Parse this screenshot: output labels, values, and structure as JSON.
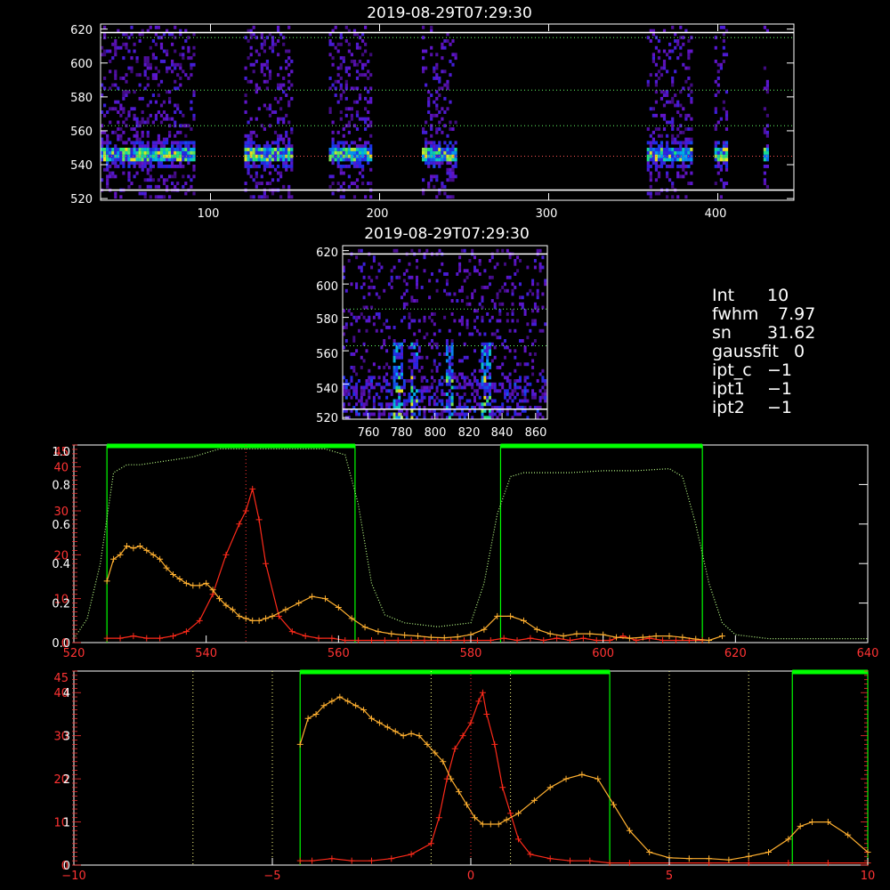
{
  "panel1": {
    "title": "2019-08-29T07:29:30",
    "x_ticks": [
      "100",
      "200",
      "300",
      "400"
    ],
    "y_ticks": [
      "520",
      "540",
      "560",
      "580",
      "600",
      "620"
    ]
  },
  "panel2": {
    "title": "2019-08-29T07:29:30",
    "x_ticks": [
      "760",
      "780",
      "800",
      "820",
      "840",
      "860"
    ],
    "y_ticks": [
      "520",
      "540",
      "560",
      "580",
      "600",
      "620"
    ]
  },
  "info": {
    "rows": [
      {
        "key": "Int",
        "value": "10"
      },
      {
        "key": "fwhm",
        "value": "7.97"
      },
      {
        "key": "sn",
        "value": "31.62"
      },
      {
        "key": "gaussfit",
        "value": "0"
      },
      {
        "key": "ipt_c",
        "value": "−1"
      },
      {
        "key": "ipt1",
        "value": "−1"
      },
      {
        "key": "ipt2",
        "value": "−1"
      }
    ]
  },
  "colors": {
    "axis": "#ffffff",
    "red": "#ff2a1a",
    "orange": "#ffb030",
    "green": "#00ff00",
    "lightgreen": "#bbff88",
    "yellow_dots": "#ffff88"
  },
  "chart_data": [
    {
      "type": "heatmap",
      "title": "2019-08-29T07:29:30",
      "xlim": [
        35,
        445
      ],
      "ylim": [
        519,
        623
      ],
      "x_ticks": [
        100,
        200,
        300,
        400
      ],
      "y_ticks": [
        520,
        540,
        560,
        580,
        600,
        620
      ],
      "bright_band_y": 545,
      "column_groups": [
        [
          35,
          90
        ],
        [
          120,
          148
        ],
        [
          170,
          195
        ],
        [
          225,
          245
        ],
        [
          358,
          385
        ],
        [
          398,
          405
        ],
        [
          427,
          430
        ]
      ],
      "reference_lines_y": [
        525,
        545,
        563,
        584,
        615,
        618
      ]
    },
    {
      "type": "heatmap",
      "title": "2019-08-29T07:29:30",
      "xlim": [
        745,
        867
      ],
      "ylim": [
        519,
        623
      ],
      "x_ticks": [
        760,
        780,
        800,
        820,
        840,
        860
      ],
      "y_ticks": [
        520,
        540,
        560,
        580,
        600,
        620
      ],
      "bright_columns_x": [
        777,
        787,
        808,
        830
      ],
      "reference_lines_y": [
        525,
        563,
        585,
        618
      ]
    },
    {
      "type": "line",
      "xlim": [
        520,
        640
      ],
      "x_ticks": [
        520,
        540,
        560,
        580,
        600,
        620,
        640
      ],
      "left_axis_outer": {
        "ticks": [
          "0",
          "10",
          "20",
          "30",
          "40"
        ],
        "top_label": "45",
        "color": "#ff2a1a",
        "ylim": [
          0,
          45
        ]
      },
      "left_axis_inner": {
        "ticks": [
          "0.0",
          "0.2",
          "0.4",
          "0.6",
          "0.8"
        ],
        "top_label": "1.0",
        "color": "#ffffff",
        "ylim": [
          0,
          1.0
        ]
      },
      "vertical_marker_x": 546,
      "green_bars": [
        [
          525,
          562.5
        ],
        [
          584.5,
          615
        ]
      ],
      "series": [
        {
          "color": "#ff2a1a",
          "axis": "outer",
          "x": [
            525,
            527,
            529,
            531,
            533,
            535,
            537,
            539,
            541,
            543,
            545,
            546,
            547,
            548,
            549,
            551,
            553,
            555,
            557,
            559,
            561,
            563,
            565,
            567,
            569,
            571,
            573,
            575,
            577,
            579,
            581,
            583,
            585,
            587,
            589,
            591,
            593,
            595,
            597,
            599,
            601,
            603,
            605,
            607,
            609,
            611,
            613,
            615
          ],
          "y": [
            1,
            1,
            1.5,
            1,
            1,
            1.5,
            2.5,
            5,
            11,
            20,
            27,
            30,
            35,
            28,
            18,
            6,
            2.5,
            1.5,
            1,
            1,
            0.5,
            0.5,
            0.5,
            0.5,
            0.5,
            0.5,
            0.5,
            0.5,
            0.5,
            0.5,
            0.5,
            0.5,
            1,
            0.5,
            1,
            0.5,
            1,
            0.5,
            1,
            0.5,
            0.5,
            1.5,
            0.5,
            1,
            0.5,
            0.5,
            0.5,
            0.5
          ]
        },
        {
          "color": "#ffb030",
          "axis": "outer",
          "x": [
            525,
            526,
            527,
            528,
            529,
            530,
            531,
            532,
            533,
            534,
            535,
            536,
            537,
            538,
            539,
            540,
            541,
            542,
            543,
            544,
            545,
            546,
            547,
            548,
            549,
            550,
            552,
            554,
            556,
            558,
            560,
            562,
            564,
            566,
            568,
            570,
            572,
            574,
            576,
            578,
            580,
            582,
            584,
            586,
            588,
            590,
            592,
            594,
            596,
            598,
            600,
            602,
            604,
            606,
            608,
            610,
            612,
            614,
            616,
            618
          ],
          "y": [
            14,
            19,
            20,
            22,
            21.5,
            22,
            21,
            20,
            19,
            17,
            15.5,
            14.5,
            13.5,
            13,
            13,
            13.5,
            12,
            10,
            8.5,
            7.5,
            6,
            5.5,
            5,
            5,
            5.5,
            6,
            7.5,
            9,
            10.5,
            10,
            8,
            5.5,
            3.5,
            2.5,
            2,
            1.7,
            1.5,
            1.2,
            1.1,
            1.3,
            1.8,
            3,
            6,
            6,
            5,
            3,
            2,
            1.5,
            2,
            2,
            1.8,
            1.2,
            1,
            1.2,
            1.5,
            1.5,
            1.2,
            0.8,
            0.5,
            1.5
          ]
        },
        {
          "color": "#bbff88",
          "axis": "inner",
          "style": "dotted",
          "x": [
            520,
            522,
            524,
            526,
            528,
            530,
            534,
            538,
            542,
            546,
            550,
            554,
            558,
            561,
            563,
            565,
            567,
            570,
            575,
            580,
            582,
            584,
            586,
            588,
            590,
            595,
            600,
            605,
            610,
            612,
            614,
            616,
            618,
            620,
            625,
            630,
            640
          ],
          "y": [
            0.02,
            0.12,
            0.4,
            0.86,
            0.9,
            0.9,
            0.92,
            0.94,
            0.98,
            0.98,
            0.98,
            0.98,
            0.98,
            0.95,
            0.7,
            0.3,
            0.14,
            0.1,
            0.08,
            0.1,
            0.3,
            0.65,
            0.84,
            0.86,
            0.86,
            0.86,
            0.87,
            0.87,
            0.88,
            0.84,
            0.6,
            0.3,
            0.1,
            0.04,
            0.02,
            0.02,
            0.02
          ]
        }
      ]
    },
    {
      "type": "line",
      "xlim": [
        -10,
        10
      ],
      "x_ticks": [
        -10,
        -5,
        0,
        5,
        10
      ],
      "left_axis_outer": {
        "ticks": [
          "0",
          "10",
          "20",
          "30",
          "40"
        ],
        "top_label": "45",
        "color": "#ff2a1a",
        "ylim": [
          0,
          45
        ]
      },
      "left_axis_inner": {
        "ticks": [
          "0",
          "1",
          "2",
          "3",
          "4"
        ],
        "ylim": [
          0,
          4.5
        ]
      },
      "dotted_vertical_lines_x": [
        -7,
        -5,
        -1,
        0,
        1,
        5,
        7
      ],
      "green_bars": [
        [
          -4.3,
          3.5
        ],
        [
          8.1,
          10
        ]
      ],
      "series": [
        {
          "color": "#ff2a1a",
          "axis": "outer",
          "x": [
            -4.3,
            -4,
            -3.5,
            -3,
            -2.5,
            -2,
            -1.5,
            -1,
            -0.8,
            -0.6,
            -0.4,
            -0.2,
            0,
            0.2,
            0.3,
            0.4,
            0.6,
            0.8,
            1,
            1.2,
            1.5,
            2,
            2.5,
            3,
            3.5,
            4,
            5,
            6,
            7,
            8,
            9,
            10
          ],
          "y": [
            1,
            1,
            1.5,
            1,
            1,
            1.5,
            2.5,
            5,
            11,
            20,
            27,
            30,
            33,
            38,
            40,
            35,
            28,
            18,
            12,
            6,
            2.5,
            1.5,
            1,
            1,
            0.5,
            0.5,
            0.5,
            0.5,
            0.5,
            0.5,
            0.5,
            0.5
          ]
        },
        {
          "color": "#ffb030",
          "axis": "outer",
          "x": [
            -4.3,
            -4.1,
            -3.9,
            -3.7,
            -3.5,
            -3.3,
            -3.1,
            -2.9,
            -2.7,
            -2.5,
            -2.3,
            -2.1,
            -1.9,
            -1.7,
            -1.5,
            -1.3,
            -1.1,
            -0.9,
            -0.7,
            -0.5,
            -0.3,
            -0.1,
            0.1,
            0.3,
            0.5,
            0.7,
            0.9,
            1.2,
            1.6,
            2,
            2.4,
            2.8,
            3.2,
            3.6,
            4,
            4.5,
            5,
            5.5,
            6,
            6.5,
            7,
            7.5,
            8,
            8.3,
            8.6,
            9,
            9.5,
            10
          ],
          "y": [
            28,
            34,
            35,
            37,
            38,
            39,
            38,
            37,
            36,
            34,
            33,
            32,
            31,
            30,
            30.5,
            30,
            28,
            26,
            24,
            20,
            17,
            14,
            11,
            9.5,
            9.5,
            9.5,
            10.5,
            12,
            15,
            18,
            20,
            21,
            20,
            14,
            8,
            3,
            1.7,
            1.5,
            1.5,
            1.2,
            2,
            3,
            6,
            9,
            10,
            10,
            7,
            3
          ]
        }
      ]
    }
  ]
}
